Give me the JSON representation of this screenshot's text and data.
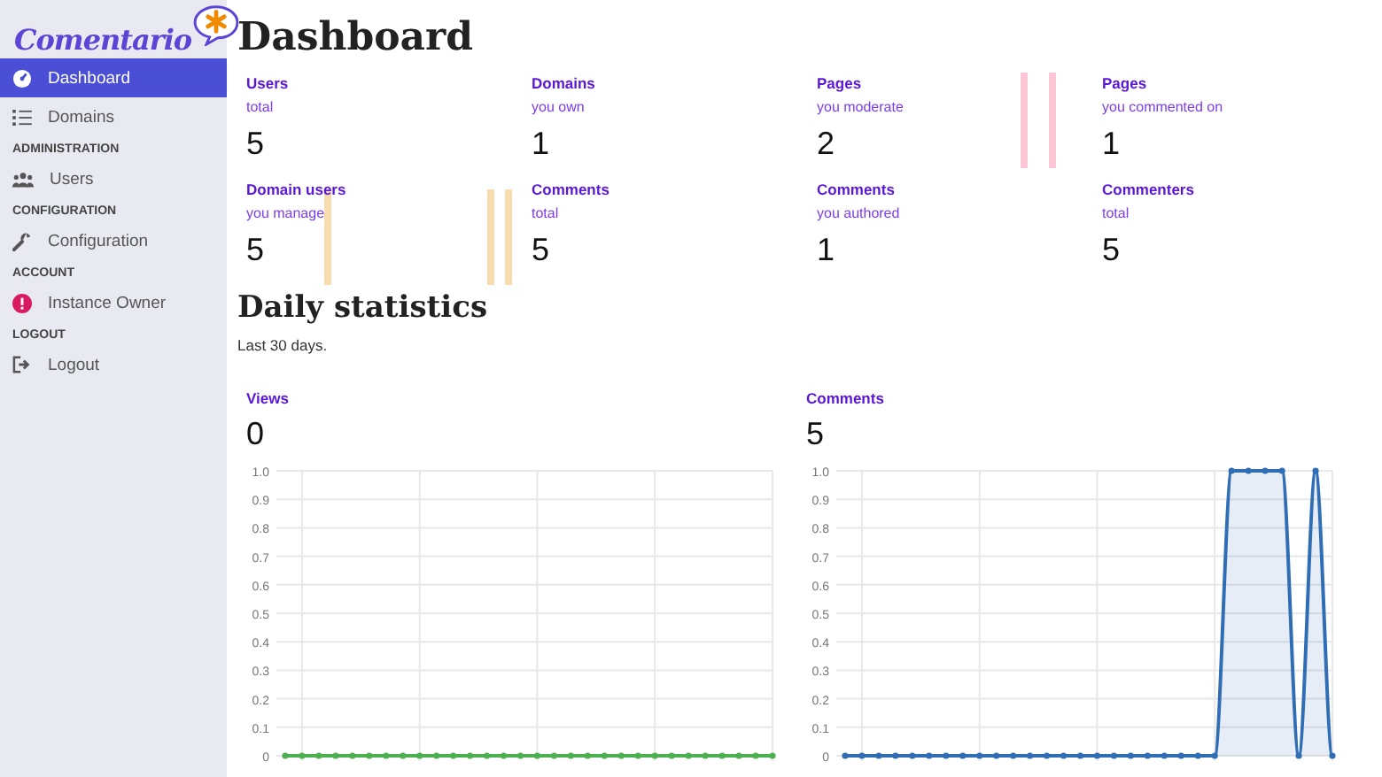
{
  "sidebar": {
    "logo": "Comentario",
    "items": [
      {
        "kind": "item",
        "label": "Dashboard",
        "selected": true
      },
      {
        "kind": "item",
        "label": "Domains",
        "selected": false
      },
      {
        "kind": "heading",
        "label": "ADMINISTRATION"
      },
      {
        "kind": "item",
        "label": "Users",
        "selected": false
      },
      {
        "kind": "heading",
        "label": "CONFIGURATION"
      },
      {
        "kind": "item",
        "label": "Configuration",
        "selected": false
      },
      {
        "kind": "heading",
        "label": "ACCOUNT"
      },
      {
        "kind": "item",
        "label": "Instance Owner",
        "selected": false
      },
      {
        "kind": "heading",
        "label": "LOGOUT"
      },
      {
        "kind": "item",
        "label": "Logout",
        "selected": false
      }
    ]
  },
  "title": "Dashboard",
  "stats": [
    {
      "label": "Users",
      "sub": "total",
      "value": "5"
    },
    {
      "label": "Domains",
      "sub": "you own",
      "value": "1"
    },
    {
      "label": "Pages",
      "sub": "you moderate",
      "value": "2"
    },
    {
      "label": "Pages",
      "sub": "you commented on",
      "value": "1"
    },
    {
      "label": "Domain users",
      "sub": "you manage",
      "value": "5"
    },
    {
      "label": "Comments",
      "sub": "total",
      "value": "5"
    },
    {
      "label": "Comments",
      "sub": "you authored",
      "value": "1"
    },
    {
      "label": "Commenters",
      "sub": "total",
      "value": "5"
    }
  ],
  "daily": {
    "title": "Daily statistics",
    "subtitle": "Last 30 days.",
    "charts": [
      {
        "label": "Views",
        "value": "0",
        "chart_data": {
          "type": "line",
          "grid": true,
          "ylim": [
            0,
            1
          ],
          "yticks": [
            0,
            0.1,
            0.2,
            0.3,
            0.4,
            0.5,
            0.6,
            0.7,
            0.8,
            0.9,
            {
              "value": 1,
              "label": "1.0"
            }
          ],
          "series": [
            {
              "marker": "o",
              "color": "#4caf50",
              "values": [
                0,
                0,
                0,
                0,
                0,
                0,
                0,
                0,
                0,
                0,
                0,
                0,
                0,
                0,
                0,
                0,
                0,
                0,
                0,
                0,
                0,
                0,
                0,
                0,
                0,
                0,
                0,
                0,
                0,
                0
              ]
            }
          ]
        }
      },
      {
        "label": "Comments",
        "value": "5",
        "chart_data": {
          "type": "area",
          "grid": true,
          "ylim": [
            0,
            1
          ],
          "yticks": [
            0,
            0.1,
            0.2,
            0.3,
            0.4,
            0.5,
            0.6,
            0.7,
            0.8,
            0.9,
            {
              "value": 1,
              "label": "1.0"
            }
          ],
          "series": [
            {
              "marker": "o",
              "color": "#2f6db5",
              "values": [
                0,
                0,
                0,
                0,
                0,
                0,
                0,
                0,
                0,
                0,
                0,
                0,
                0,
                0,
                0,
                0,
                0,
                0,
                0,
                0,
                0,
                0,
                0,
                1,
                1,
                1,
                1,
                0,
                1,
                0
              ]
            }
          ]
        }
      }
    ]
  }
}
